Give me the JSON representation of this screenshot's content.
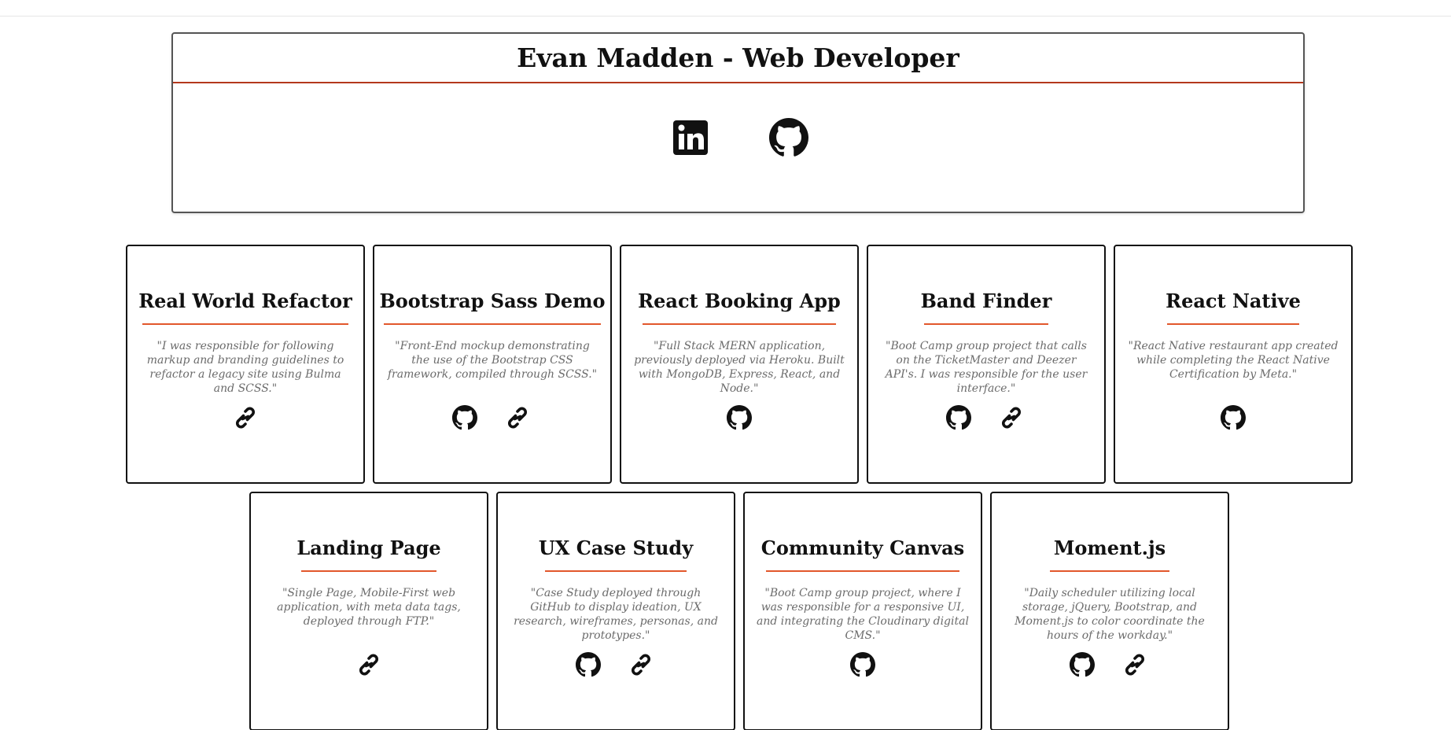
{
  "header": {
    "title": "Evan Madden - Web Developer",
    "social": [
      {
        "name": "linkedin-icon",
        "label": "LinkedIn"
      },
      {
        "name": "github-icon",
        "label": "GitHub"
      }
    ]
  },
  "projects": [
    {
      "title": "Real World Refactor",
      "description": "\"I was responsible for following markup and branding guidelines to refactor a legacy site using Bulma and SCSS.\"",
      "icons": [
        "link-icon"
      ]
    },
    {
      "title": "Bootstrap Sass Demo",
      "description": "\"Front-End mockup demonstrating the use of the Bootstrap CSS framework, compiled through SCSS.\"",
      "icons": [
        "github-icon",
        "link-icon"
      ]
    },
    {
      "title": "React Booking App",
      "description": "\"Full Stack MERN application, previously deployed via Heroku. Built with MongoDB, Express, React, and Node.\"",
      "icons": [
        "github-icon"
      ]
    },
    {
      "title": "Band Finder",
      "description": "\"Boot Camp group project that calls on the TicketMaster and Deezer API's. I was responsible for the user interface.\"",
      "icons": [
        "github-icon",
        "link-icon"
      ]
    },
    {
      "title": "React Native",
      "description": "\"React Native restaurant app created while completing the React Native Certification by Meta.\"",
      "icons": [
        "github-icon"
      ]
    },
    {
      "title": "Landing Page",
      "description": "\"Single Page, Mobile-First web application, with meta data tags, deployed through FTP.\"",
      "icons": [
        "link-icon"
      ]
    },
    {
      "title": "UX Case Study",
      "description": "\"Case Study deployed through GitHub to display ideation, UX research, wireframes, personas, and prototypes.\"",
      "icons": [
        "github-icon",
        "link-icon"
      ]
    },
    {
      "title": "Community Canvas",
      "description": "\"Boot Camp group project, where I was responsible for a responsive UI, and integrating the Cloudinary digital CMS.\"",
      "icons": [
        "github-icon"
      ]
    },
    {
      "title": "Moment.js",
      "description": "\"Daily scheduler utilizing local storage, jQuery, Bootstrap, and Moment.js to color coordinate the hours of the workday.\"",
      "icons": [
        "github-icon",
        "link-icon"
      ]
    }
  ],
  "colors": {
    "accent": "#e2572b",
    "header_rule": "#b4381c",
    "description_text": "#6b6b6b",
    "border": "#111111"
  }
}
